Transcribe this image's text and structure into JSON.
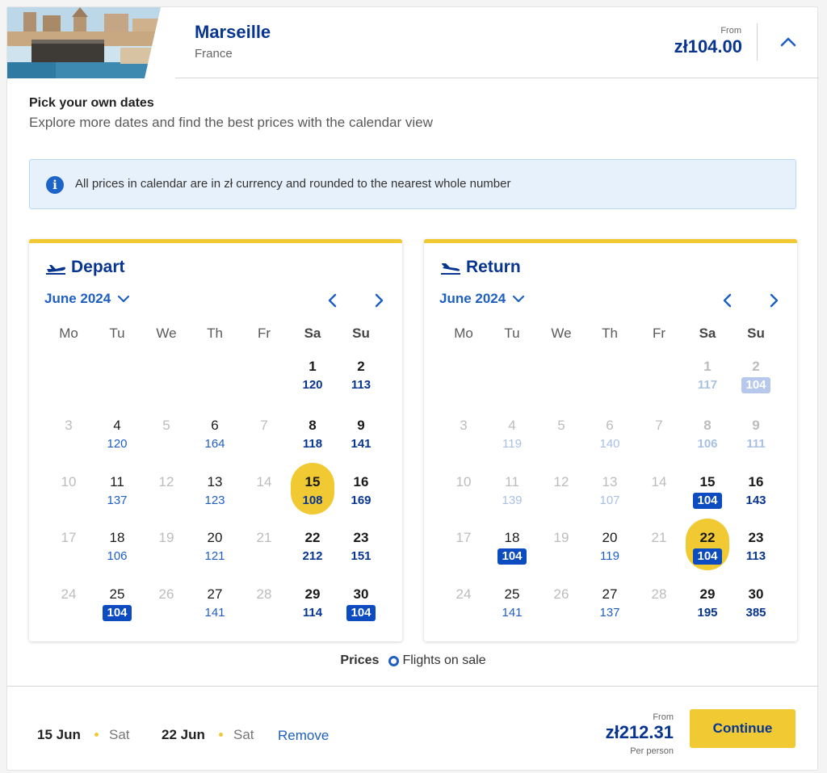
{
  "header": {
    "city": "Marseille",
    "country": "France",
    "from_label": "From",
    "from_price": "zł104.00",
    "collapse_icon": "chevron-up-icon"
  },
  "pick": {
    "title": "Pick your own dates",
    "subtitle": "Explore more dates and find the best prices with the calendar view"
  },
  "info": {
    "icon": "info-icon",
    "text": "All prices in calendar are in zł currency and rounded to the nearest whole number"
  },
  "depart": {
    "title": "Depart",
    "icon": "plane-takeoff-icon",
    "month": "June 2024",
    "weekdays": [
      "Mo",
      "Tu",
      "We",
      "Th",
      "Fr",
      "Sa",
      "Su"
    ],
    "days": [
      {
        "d": "1",
        "p": "120",
        "c": 5,
        "r": 0
      },
      {
        "d": "2",
        "p": "113",
        "c": 6,
        "r": 0
      },
      {
        "d": "3",
        "p": "",
        "c": 0,
        "r": 1,
        "faded": true
      },
      {
        "d": "4",
        "p": "120",
        "c": 1,
        "r": 1
      },
      {
        "d": "5",
        "p": "",
        "c": 2,
        "r": 1,
        "faded": true
      },
      {
        "d": "6",
        "p": "164",
        "c": 3,
        "r": 1
      },
      {
        "d": "7",
        "p": "",
        "c": 4,
        "r": 1,
        "faded": true
      },
      {
        "d": "8",
        "p": "118",
        "c": 5,
        "r": 1
      },
      {
        "d": "9",
        "p": "141",
        "c": 6,
        "r": 1
      },
      {
        "d": "10",
        "p": "",
        "c": 0,
        "r": 2,
        "faded": true
      },
      {
        "d": "11",
        "p": "137",
        "c": 1,
        "r": 2
      },
      {
        "d": "12",
        "p": "",
        "c": 2,
        "r": 2,
        "faded": true
      },
      {
        "d": "13",
        "p": "123",
        "c": 3,
        "r": 2
      },
      {
        "d": "14",
        "p": "",
        "c": 4,
        "r": 2,
        "faded": true
      },
      {
        "d": "15",
        "p": "108",
        "c": 5,
        "r": 2,
        "selected": true
      },
      {
        "d": "16",
        "p": "169",
        "c": 6,
        "r": 2
      },
      {
        "d": "17",
        "p": "",
        "c": 0,
        "r": 3,
        "faded": true
      },
      {
        "d": "18",
        "p": "106",
        "c": 1,
        "r": 3
      },
      {
        "d": "19",
        "p": "",
        "c": 2,
        "r": 3,
        "faded": true
      },
      {
        "d": "20",
        "p": "121",
        "c": 3,
        "r": 3
      },
      {
        "d": "21",
        "p": "",
        "c": 4,
        "r": 3,
        "faded": true
      },
      {
        "d": "22",
        "p": "212",
        "c": 5,
        "r": 3
      },
      {
        "d": "23",
        "p": "151",
        "c": 6,
        "r": 3
      },
      {
        "d": "24",
        "p": "",
        "c": 0,
        "r": 4,
        "faded": true
      },
      {
        "d": "25",
        "p": "104",
        "c": 1,
        "r": 4,
        "sale": true
      },
      {
        "d": "26",
        "p": "",
        "c": 2,
        "r": 4,
        "faded": true
      },
      {
        "d": "27",
        "p": "141",
        "c": 3,
        "r": 4
      },
      {
        "d": "28",
        "p": "",
        "c": 4,
        "r": 4,
        "faded": true
      },
      {
        "d": "29",
        "p": "114",
        "c": 5,
        "r": 4
      },
      {
        "d": "30",
        "p": "104",
        "c": 6,
        "r": 4,
        "sale": true
      }
    ]
  },
  "return": {
    "title": "Return",
    "icon": "plane-landing-icon",
    "month": "June 2024",
    "weekdays": [
      "Mo",
      "Tu",
      "We",
      "Th",
      "Fr",
      "Sa",
      "Su"
    ],
    "days": [
      {
        "d": "1",
        "p": "117",
        "c": 5,
        "r": 0,
        "faded": true
      },
      {
        "d": "2",
        "p": "104",
        "c": 6,
        "r": 0,
        "faded": true,
        "sale": true
      },
      {
        "d": "3",
        "p": "",
        "c": 0,
        "r": 1,
        "faded": true
      },
      {
        "d": "4",
        "p": "119",
        "c": 1,
        "r": 1,
        "faded": true
      },
      {
        "d": "5",
        "p": "",
        "c": 2,
        "r": 1,
        "faded": true
      },
      {
        "d": "6",
        "p": "140",
        "c": 3,
        "r": 1,
        "faded": true
      },
      {
        "d": "7",
        "p": "",
        "c": 4,
        "r": 1,
        "faded": true
      },
      {
        "d": "8",
        "p": "106",
        "c": 5,
        "r": 1,
        "faded": true
      },
      {
        "d": "9",
        "p": "111",
        "c": 6,
        "r": 1,
        "faded": true
      },
      {
        "d": "10",
        "p": "",
        "c": 0,
        "r": 2,
        "faded": true
      },
      {
        "d": "11",
        "p": "139",
        "c": 1,
        "r": 2,
        "faded": true
      },
      {
        "d": "12",
        "p": "",
        "c": 2,
        "r": 2,
        "faded": true
      },
      {
        "d": "13",
        "p": "107",
        "c": 3,
        "r": 2,
        "faded": true
      },
      {
        "d": "14",
        "p": "",
        "c": 4,
        "r": 2,
        "faded": true
      },
      {
        "d": "15",
        "p": "104",
        "c": 5,
        "r": 2,
        "sale": true
      },
      {
        "d": "16",
        "p": "143",
        "c": 6,
        "r": 2
      },
      {
        "d": "17",
        "p": "",
        "c": 0,
        "r": 3,
        "faded": true
      },
      {
        "d": "18",
        "p": "104",
        "c": 1,
        "r": 3,
        "sale": true
      },
      {
        "d": "19",
        "p": "",
        "c": 2,
        "r": 3,
        "faded": true
      },
      {
        "d": "20",
        "p": "119",
        "c": 3,
        "r": 3
      },
      {
        "d": "21",
        "p": "",
        "c": 4,
        "r": 3,
        "faded": true
      },
      {
        "d": "22",
        "p": "104",
        "c": 5,
        "r": 3,
        "selected": true,
        "sale": true
      },
      {
        "d": "23",
        "p": "113",
        "c": 6,
        "r": 3
      },
      {
        "d": "24",
        "p": "",
        "c": 0,
        "r": 4,
        "faded": true
      },
      {
        "d": "25",
        "p": "141",
        "c": 1,
        "r": 4
      },
      {
        "d": "26",
        "p": "",
        "c": 2,
        "r": 4,
        "faded": true
      },
      {
        "d": "27",
        "p": "137",
        "c": 3,
        "r": 4
      },
      {
        "d": "28",
        "p": "",
        "c": 4,
        "r": 4,
        "faded": true
      },
      {
        "d": "29",
        "p": "195",
        "c": 5,
        "r": 4
      },
      {
        "d": "30",
        "p": "385",
        "c": 6,
        "r": 4
      }
    ]
  },
  "legend": {
    "label": "Prices",
    "item": "Flights on sale"
  },
  "footer": {
    "depart_date": "15 Jun",
    "depart_dow": "Sat",
    "return_date": "22 Jun",
    "return_dow": "Sat",
    "remove_label": "Remove",
    "from_label": "From",
    "price": "zł212.31",
    "per_person": "Per person",
    "continue_label": "Continue"
  },
  "colors": {
    "brand_blue": "#073590",
    "link_blue": "#1e5fc1",
    "accent_yellow": "#f1c933",
    "sale_blue": "#0c4cc0"
  }
}
